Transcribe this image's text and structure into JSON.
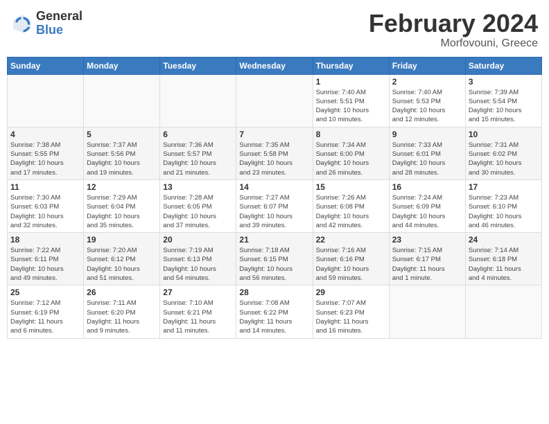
{
  "header": {
    "logo_general": "General",
    "logo_blue": "Blue",
    "title": "February 2024",
    "subtitle": "Morfovouni, Greece"
  },
  "weekdays": [
    "Sunday",
    "Monday",
    "Tuesday",
    "Wednesday",
    "Thursday",
    "Friday",
    "Saturday"
  ],
  "weeks": [
    [
      {
        "day": "",
        "info": ""
      },
      {
        "day": "",
        "info": ""
      },
      {
        "day": "",
        "info": ""
      },
      {
        "day": "",
        "info": ""
      },
      {
        "day": "1",
        "info": "Sunrise: 7:40 AM\nSunset: 5:51 PM\nDaylight: 10 hours\nand 10 minutes."
      },
      {
        "day": "2",
        "info": "Sunrise: 7:40 AM\nSunset: 5:53 PM\nDaylight: 10 hours\nand 12 minutes."
      },
      {
        "day": "3",
        "info": "Sunrise: 7:39 AM\nSunset: 5:54 PM\nDaylight: 10 hours\nand 15 minutes."
      }
    ],
    [
      {
        "day": "4",
        "info": "Sunrise: 7:38 AM\nSunset: 5:55 PM\nDaylight: 10 hours\nand 17 minutes."
      },
      {
        "day": "5",
        "info": "Sunrise: 7:37 AM\nSunset: 5:56 PM\nDaylight: 10 hours\nand 19 minutes."
      },
      {
        "day": "6",
        "info": "Sunrise: 7:36 AM\nSunset: 5:57 PM\nDaylight: 10 hours\nand 21 minutes."
      },
      {
        "day": "7",
        "info": "Sunrise: 7:35 AM\nSunset: 5:58 PM\nDaylight: 10 hours\nand 23 minutes."
      },
      {
        "day": "8",
        "info": "Sunrise: 7:34 AM\nSunset: 6:00 PM\nDaylight: 10 hours\nand 26 minutes."
      },
      {
        "day": "9",
        "info": "Sunrise: 7:33 AM\nSunset: 6:01 PM\nDaylight: 10 hours\nand 28 minutes."
      },
      {
        "day": "10",
        "info": "Sunrise: 7:31 AM\nSunset: 6:02 PM\nDaylight: 10 hours\nand 30 minutes."
      }
    ],
    [
      {
        "day": "11",
        "info": "Sunrise: 7:30 AM\nSunset: 6:03 PM\nDaylight: 10 hours\nand 32 minutes."
      },
      {
        "day": "12",
        "info": "Sunrise: 7:29 AM\nSunset: 6:04 PM\nDaylight: 10 hours\nand 35 minutes."
      },
      {
        "day": "13",
        "info": "Sunrise: 7:28 AM\nSunset: 6:05 PM\nDaylight: 10 hours\nand 37 minutes."
      },
      {
        "day": "14",
        "info": "Sunrise: 7:27 AM\nSunset: 6:07 PM\nDaylight: 10 hours\nand 39 minutes."
      },
      {
        "day": "15",
        "info": "Sunrise: 7:26 AM\nSunset: 6:08 PM\nDaylight: 10 hours\nand 42 minutes."
      },
      {
        "day": "16",
        "info": "Sunrise: 7:24 AM\nSunset: 6:09 PM\nDaylight: 10 hours\nand 44 minutes."
      },
      {
        "day": "17",
        "info": "Sunrise: 7:23 AM\nSunset: 6:10 PM\nDaylight: 10 hours\nand 46 minutes."
      }
    ],
    [
      {
        "day": "18",
        "info": "Sunrise: 7:22 AM\nSunset: 6:11 PM\nDaylight: 10 hours\nand 49 minutes."
      },
      {
        "day": "19",
        "info": "Sunrise: 7:20 AM\nSunset: 6:12 PM\nDaylight: 10 hours\nand 51 minutes."
      },
      {
        "day": "20",
        "info": "Sunrise: 7:19 AM\nSunset: 6:13 PM\nDaylight: 10 hours\nand 54 minutes."
      },
      {
        "day": "21",
        "info": "Sunrise: 7:18 AM\nSunset: 6:15 PM\nDaylight: 10 hours\nand 56 minutes."
      },
      {
        "day": "22",
        "info": "Sunrise: 7:16 AM\nSunset: 6:16 PM\nDaylight: 10 hours\nand 59 minutes."
      },
      {
        "day": "23",
        "info": "Sunrise: 7:15 AM\nSunset: 6:17 PM\nDaylight: 11 hours\nand 1 minute."
      },
      {
        "day": "24",
        "info": "Sunrise: 7:14 AM\nSunset: 6:18 PM\nDaylight: 11 hours\nand 4 minutes."
      }
    ],
    [
      {
        "day": "25",
        "info": "Sunrise: 7:12 AM\nSunset: 6:19 PM\nDaylight: 11 hours\nand 6 minutes."
      },
      {
        "day": "26",
        "info": "Sunrise: 7:11 AM\nSunset: 6:20 PM\nDaylight: 11 hours\nand 9 minutes."
      },
      {
        "day": "27",
        "info": "Sunrise: 7:10 AM\nSunset: 6:21 PM\nDaylight: 11 hours\nand 11 minutes."
      },
      {
        "day": "28",
        "info": "Sunrise: 7:08 AM\nSunset: 6:22 PM\nDaylight: 11 hours\nand 14 minutes."
      },
      {
        "day": "29",
        "info": "Sunrise: 7:07 AM\nSunset: 6:23 PM\nDaylight: 11 hours\nand 16 minutes."
      },
      {
        "day": "",
        "info": ""
      },
      {
        "day": "",
        "info": ""
      }
    ]
  ]
}
